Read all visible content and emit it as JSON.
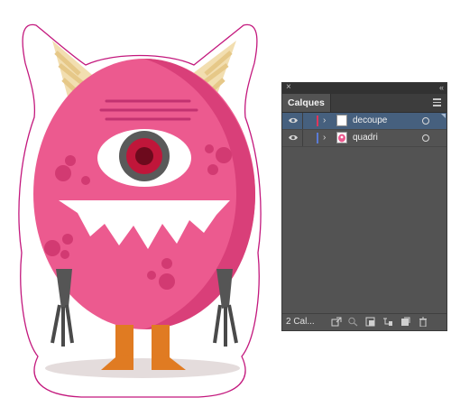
{
  "artboard": {
    "illustration": "pink-one-eyed-monster-sticker"
  },
  "panel": {
    "tab_label": "Calques",
    "layers": [
      {
        "name": "decoupe",
        "color": "#e0375b",
        "selected": true
      },
      {
        "name": "quadri",
        "color": "#5a7bd6",
        "selected": false
      }
    ],
    "layer_count": "2 Cal...",
    "bottom_tools": [
      "export-icon",
      "locate-object-icon",
      "make-clipping-mask-icon",
      "create-sublayer-icon",
      "new-layer-icon",
      "delete-icon"
    ]
  },
  "colors": {
    "monster_pink": "#ec5a8f",
    "sticker_outline": "#c3187d",
    "panel_bg": "#535353",
    "selection": "#46607e"
  }
}
